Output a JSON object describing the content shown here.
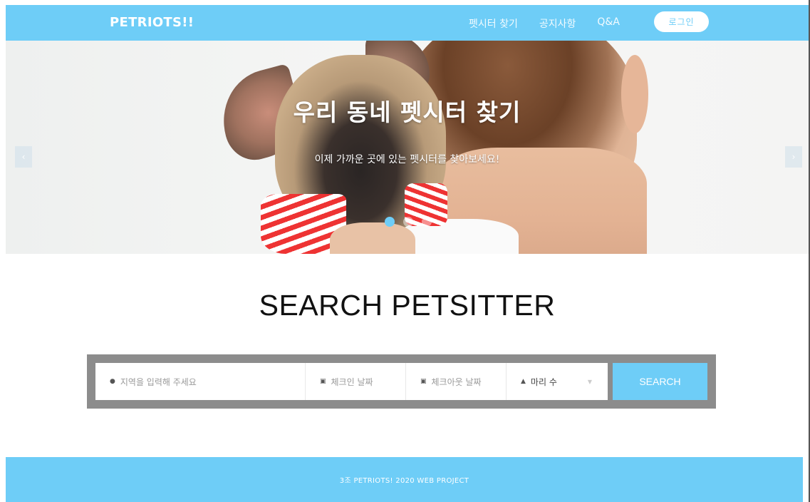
{
  "navbar": {
    "brand": "PETRIOTS!!",
    "links": [
      "펫시터 찾기",
      "공지사항",
      "Q&A"
    ],
    "login_label": "로그인"
  },
  "hero": {
    "title": "우리 동네 펫시터 찾기",
    "subtitle": "이제 가까운 곳에 있는 펫시터를 찾아보세요!",
    "prev_arrow": "‹",
    "next_arrow": "›",
    "slide_count": 3,
    "active_slide": 1
  },
  "search": {
    "title": "SEARCH PETSITTER",
    "location_placeholder": "지역을 입력해 주세요",
    "checkin_placeholder": "체크인 날짜",
    "checkout_placeholder": "체크아웃 날짜",
    "count_label": "마리 수",
    "button_label": "SEARCH"
  },
  "icons": {
    "location": "map-pin-icon",
    "calendar": "calendar-icon",
    "person": "person-icon",
    "caret": "chevron-down-icon"
  },
  "colors": {
    "accent": "#6ecdf7",
    "search_frame": "#8c8c8c"
  },
  "footer": {
    "text": "3조 PETRIOTS! 2020 WEB PROJECT"
  }
}
